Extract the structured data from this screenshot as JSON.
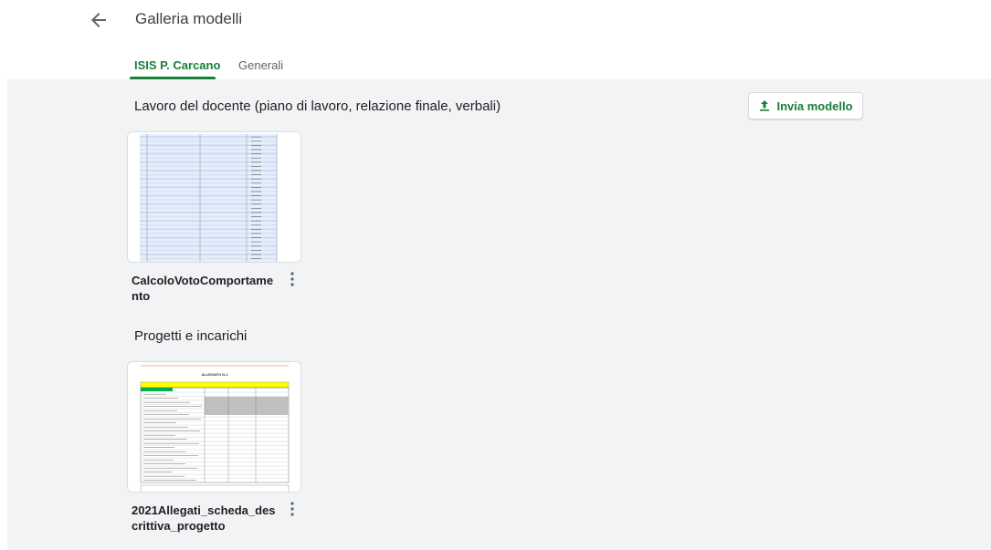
{
  "header": {
    "title": "Galleria modelli",
    "back_icon": "arrow-back-icon"
  },
  "tabs": [
    {
      "label": "ISIS P. Carcano",
      "active": true
    },
    {
      "label": "Generali",
      "active": false
    }
  ],
  "accent_color": "#188038",
  "background_color": "#f1f3f4",
  "submit": {
    "label": "Invia modello",
    "icon": "upload-icon"
  },
  "sections": [
    {
      "title": "Lavoro del docente (piano di lavoro, relazione finale, verbali)",
      "templates": [
        {
          "name": "CalcoloVotoComportamento",
          "thumb": "spreadsheet-thumbnail"
        }
      ]
    },
    {
      "title": "Progetti e incarichi",
      "templates": [
        {
          "name": "2021Allegati_scheda_descrittiva_progetto",
          "thumb": "document-thumbnail",
          "thumb_heading": "ALLEGATO N.1"
        }
      ]
    }
  ]
}
